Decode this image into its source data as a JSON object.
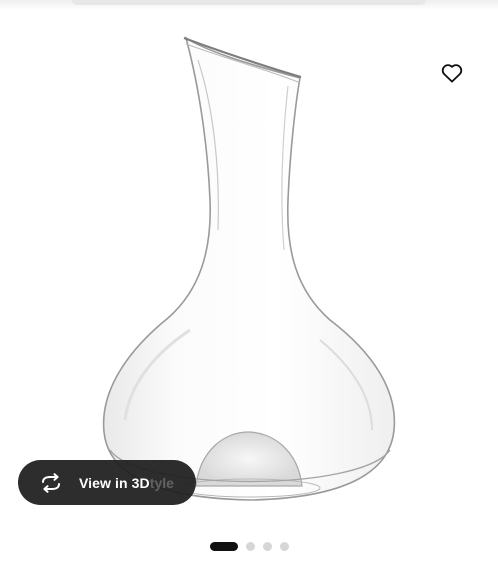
{
  "product": {
    "image_subject": "glass-carafe"
  },
  "actions": {
    "favorite_icon": "heart-icon",
    "view_3d_label": "View in 3D",
    "view_3d_overflow_text": "tyle",
    "view_3d_icon": "rotate-3d-icon"
  },
  "carousel": {
    "slide_count": 4,
    "active_index": 0
  },
  "colors": {
    "button_dark": "#202020",
    "dot_active": "#111111",
    "dot_inactive": "#d6d6d6"
  }
}
